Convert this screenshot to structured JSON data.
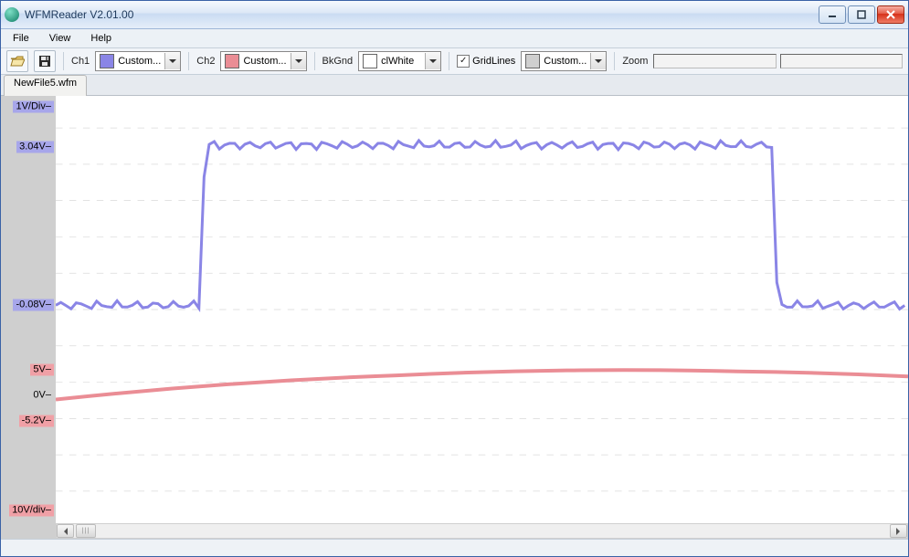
{
  "titlebar": {
    "title": "WFMReader V2.01.00"
  },
  "menu": {
    "file": "File",
    "view": "View",
    "help": "Help"
  },
  "toolbar": {
    "ch1_label": "Ch1",
    "ch1_combo": "Custom...",
    "ch2_label": "Ch2",
    "ch2_combo": "Custom...",
    "bkgnd_label": "BkGnd",
    "bkgnd_combo": "clWhite",
    "grid_label": "GridLines",
    "grid_combo": "Custom...",
    "zoom_label": "Zoom"
  },
  "colors": {
    "ch1": "#8a85e6",
    "ch2": "#ea8d95",
    "bkgnd": "#ffffff",
    "gridswatch": "#cfcfcf"
  },
  "tab": {
    "name": "NewFile5.wfm"
  },
  "axis": {
    "ch1_scale": "1V/Div",
    "ch1_max": "3.04V",
    "ch1_min": "-0.08V",
    "ch2_max": "5V",
    "ch2_zero": "0V",
    "ch2_min": "-5.2V",
    "ch2_scale": "10V/div"
  },
  "chart_data": {
    "type": "line",
    "title": "",
    "xlabel": "",
    "ylabel": "",
    "x_range": [
      0,
      100
    ],
    "series": [
      {
        "name": "Ch1",
        "color": "#8a85e6",
        "yunit": "V",
        "scale_per_div": 1,
        "ylim": [
          -6,
          6
        ],
        "levels": {
          "low": -0.08,
          "high": 3.04
        },
        "edges": {
          "rise_at_pct": 17,
          "fall_at_pct": 84
        },
        "noise_pp": 0.12
      },
      {
        "name": "Ch2",
        "color": "#ea8d95",
        "yunit": "V",
        "scale_per_div": 10,
        "ylim": [
          -60,
          60
        ],
        "points": [
          {
            "x": 0,
            "y": -1.0
          },
          {
            "x": 20,
            "y": 2.0
          },
          {
            "x": 40,
            "y": 3.8
          },
          {
            "x": 60,
            "y": 4.8
          },
          {
            "x": 80,
            "y": 4.6
          },
          {
            "x": 100,
            "y": 3.6
          }
        ]
      }
    ],
    "grid": true
  }
}
